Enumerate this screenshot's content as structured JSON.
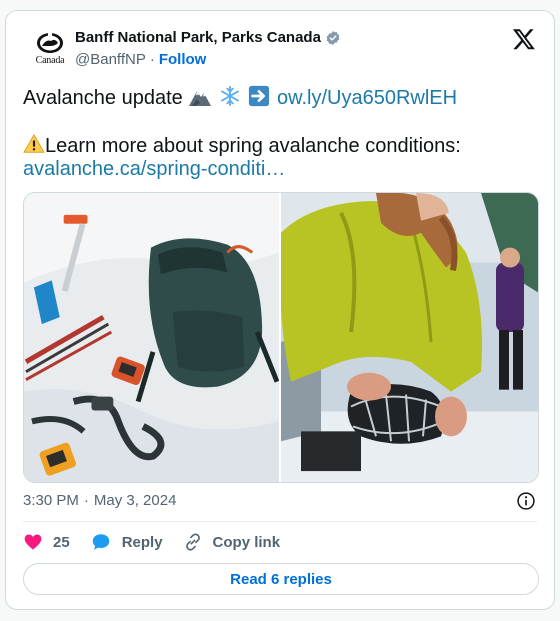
{
  "author": {
    "name": "Banff National Park, Parks Canada",
    "handle": "@BanffNP",
    "follow_label": "Follow",
    "logo_text": "Canada"
  },
  "tweet": {
    "line1_text": "Avalanche update",
    "line1_link": "ow.ly/Uya650RwlEH",
    "line2_text": "Learn more about spring avalanche conditions:",
    "line3_link": "avalanche.ca/spring-conditi…"
  },
  "meta": {
    "time": "3:30 PM",
    "separator": "·",
    "date": "May 3, 2024"
  },
  "actions": {
    "likes_count": "25",
    "reply_label": "Reply",
    "copy_link_label": "Copy link"
  },
  "replies_button_label": "Read 6 replies",
  "colors": {
    "follow_blue": "#006fd6",
    "link_blue": "#1b7aa6",
    "like_pink": "#f91880",
    "reply_blue": "#1d9bf0"
  },
  "icons": {
    "verified": "verified-badge-icon",
    "x_logo": "x-logo-icon",
    "info": "info-icon",
    "like": "heart-icon",
    "reply": "speech-bubble-icon",
    "copy_link": "link-icon"
  }
}
